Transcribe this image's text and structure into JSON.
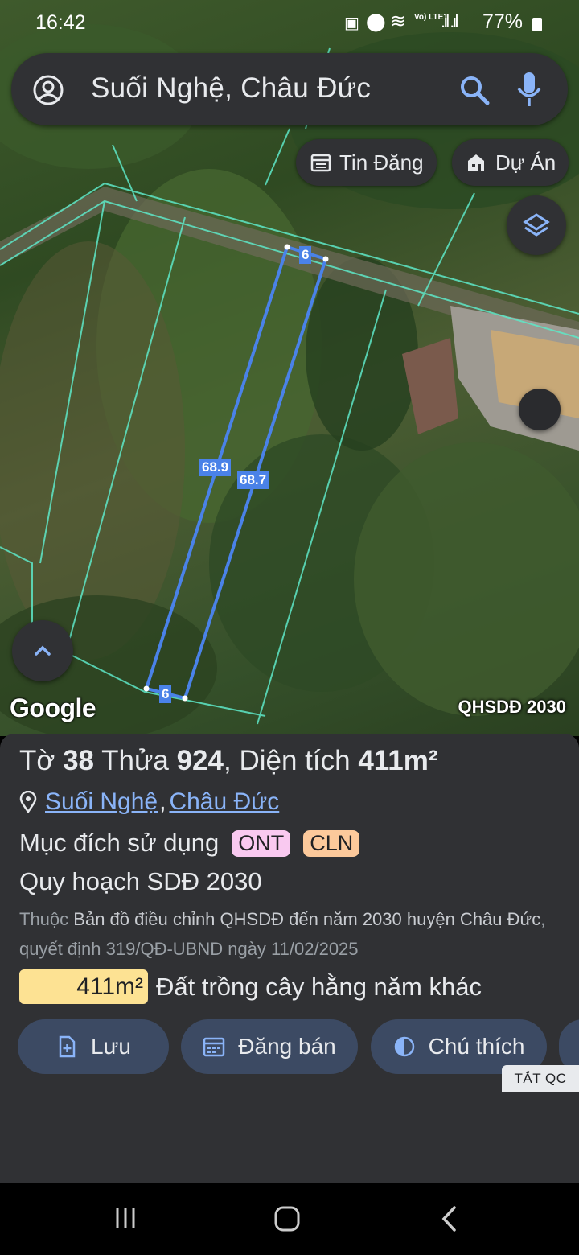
{
  "status_bar": {
    "time": "16:42",
    "network": "Vo) LTE1",
    "battery": "77%"
  },
  "search": {
    "query": "Suối Nghệ, Châu Đức"
  },
  "chips": [
    {
      "label": "Tin Đăng",
      "icon": "calendar-list-icon"
    },
    {
      "label": "Dự Án",
      "icon": "building-icon"
    }
  ],
  "map": {
    "dimension_labels": {
      "top": "6",
      "left": "68.9",
      "right": "68.7",
      "bottom": "6"
    },
    "attribution": "Google",
    "layer_label": "QHSDĐ 2030"
  },
  "panel": {
    "to_label": "Tờ",
    "to_value": "38",
    "thua_label": "Thửa",
    "thua_value": "924",
    "area_label": ", Diện tích",
    "area_value": "411m²",
    "location_commune": "Suối Nghệ",
    "location_separator": ",",
    "location_district": "Châu Đức",
    "purpose_label": "Mục đích sử dụng",
    "purpose_tags": [
      {
        "code": "ONT",
        "color": "#f9c9f0"
      },
      {
        "code": "CLN",
        "color": "#fcc99b"
      }
    ],
    "plan_title": "Quy hoạch SDĐ 2030",
    "source_prefix": "Thuộc",
    "source_name": "Bản đồ điều chỉnh QHSDĐ đến năm 2030 huyện Châu Đức",
    "source_decision": ", quyết định 319/QĐ-UBND ngày 11/02/2025",
    "area_badge": "411m²",
    "land_type": "Đất trồng cây hằng năm khác",
    "actions": [
      {
        "label": "Lưu",
        "icon": "save-doc-icon"
      },
      {
        "label": "Đăng bán",
        "icon": "calendar-icon"
      },
      {
        "label": "Chú thích",
        "icon": "half-circle-icon"
      }
    ],
    "ad_off": "TẮT QC"
  },
  "colors": {
    "accent": "#8ab4f8",
    "panel": "#303134",
    "boundary": "#4a82e8",
    "parcel_lines": "#5ee8c8"
  }
}
